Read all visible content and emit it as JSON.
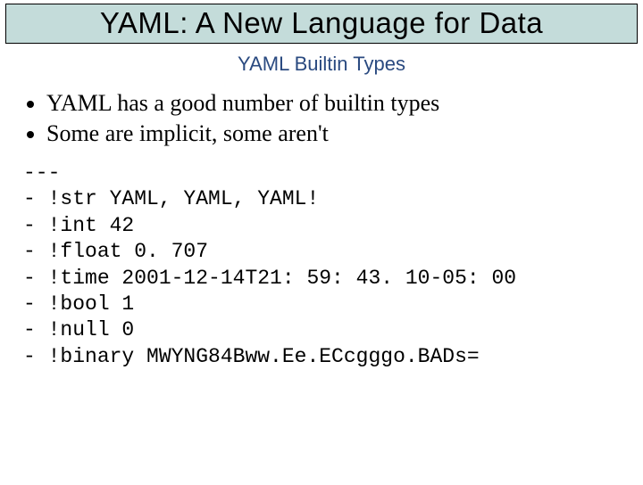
{
  "title": "YAML: A New Language for Data",
  "subtitle": "YAML Builtin Types",
  "bullets": [
    "YAML has a good number of builtin types",
    "Some are implicit, some aren't"
  ],
  "code": "---\n- !str YAML, YAML, YAML!\n- !int 42\n- !float 0. 707\n- !time 2001-12-14T21: 59: 43. 10-05: 00\n- !bool 1\n- !null 0\n- !binary MWYNG84Bww.Ee.ECcgggo.BADs="
}
